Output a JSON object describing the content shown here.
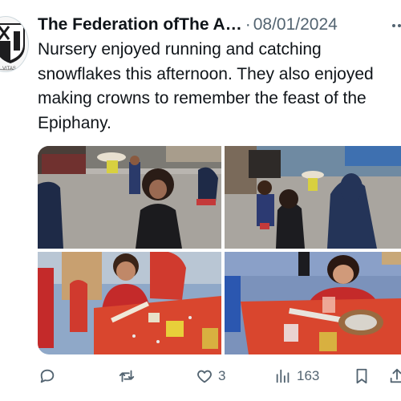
{
  "tweet": {
    "author": "The Federation ofThe A…",
    "separator": "·",
    "date": "08/01/2024",
    "text": "Nursery enjoyed running and catching snowflakes this afternoon. They also enjoyed making crowns to remember the feast of the Epiphany.",
    "avatar_text": "VITAS"
  },
  "media": [
    {
      "name": "photo-children-running-playground"
    },
    {
      "name": "photo-children-catching-snowflakes"
    },
    {
      "name": "photo-boy-making-crown"
    },
    {
      "name": "photo-girl-making-crown"
    }
  ],
  "actions": {
    "reply_icon": "reply-icon",
    "retweet_icon": "retweet-icon",
    "like_icon": "heart-icon",
    "like_count": "3",
    "views_icon": "bar-chart-icon",
    "views_count": "163",
    "bookmark_icon": "bookmark-icon",
    "share_icon": "share-icon"
  },
  "colors": {
    "text": "#0f1419",
    "secondary_text": "#536471",
    "background": "#ffffff"
  }
}
